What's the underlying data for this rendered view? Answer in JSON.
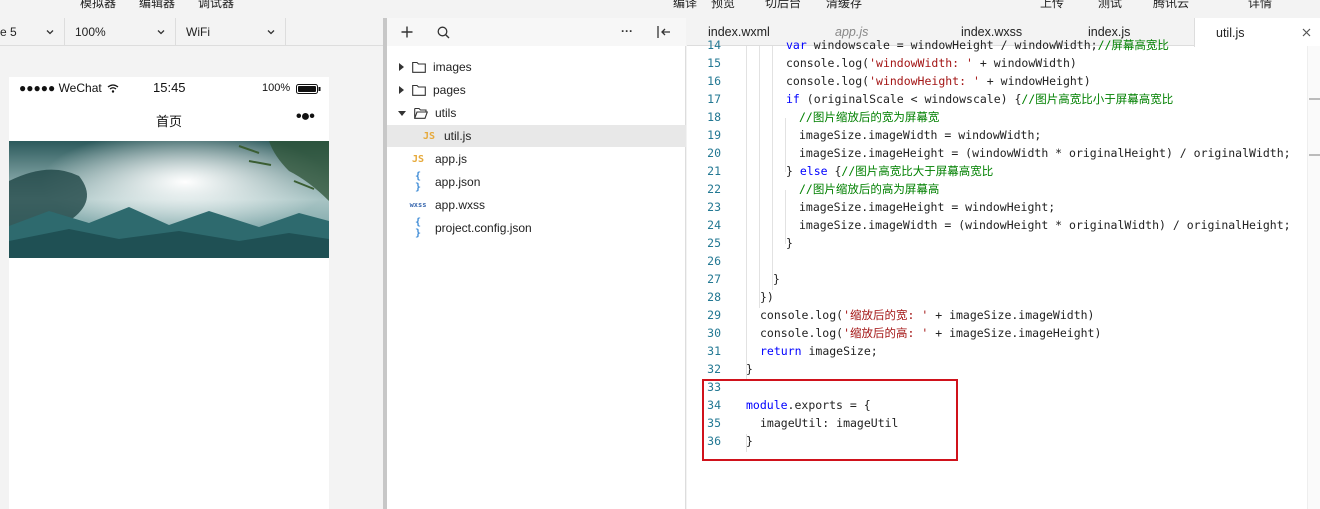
{
  "topbar": {
    "items": [
      "模拟器",
      "编辑器",
      "调试器",
      "编译",
      "预览",
      "切后台",
      "清缓存",
      "上传",
      "测试",
      "腾讯云",
      "详情"
    ]
  },
  "simulator": {
    "device": "e 5",
    "zoom": "100%",
    "network": "WiFi",
    "status": {
      "carrier": "●●●●● WeChat",
      "time": "15:45",
      "battery": "100%"
    },
    "nav_title": "首页",
    "menu_dots": "•●•"
  },
  "tree": {
    "items": [
      {
        "label": "images",
        "type": "folder"
      },
      {
        "label": "pages",
        "type": "folder"
      },
      {
        "label": "utils",
        "type": "folder-open"
      },
      {
        "label": "util.js",
        "type": "js",
        "icon": "JS"
      },
      {
        "label": "app.js",
        "type": "js",
        "icon": "JS"
      },
      {
        "label": "app.json",
        "type": "json",
        "icon": "{ }"
      },
      {
        "label": "app.wxss",
        "type": "wxss",
        "icon": "wxss"
      },
      {
        "label": "project.config.json",
        "type": "json",
        "icon": "{ }"
      }
    ],
    "more": "···"
  },
  "editor": {
    "tabs": [
      {
        "label": "index.wxml"
      },
      {
        "label": "app.js"
      },
      {
        "label": "index.wxss"
      },
      {
        "label": "index.js"
      },
      {
        "label": "util.js"
      }
    ],
    "lines": [
      {
        "n": "14",
        "text": "var windowscale = windowHeight / windowWidth;//屏幕高宽比"
      },
      {
        "n": "15",
        "text": "console.log('windowWidth: ' + windowWidth)"
      },
      {
        "n": "16",
        "text": "console.log('windowHeight: ' + windowHeight)"
      },
      {
        "n": "17",
        "text": "if (originalScale < windowscale) {//图片高宽比小于屏幕高宽比"
      },
      {
        "n": "18",
        "text": "//图片缩放后的宽为屏幕宽"
      },
      {
        "n": "19",
        "text": "imageSize.imageWidth = windowWidth;"
      },
      {
        "n": "20",
        "text": "imageSize.imageHeight = (windowWidth * originalHeight) / originalWidth;"
      },
      {
        "n": "21",
        "text": "} else {//图片高宽比大于屏幕高宽比"
      },
      {
        "n": "22",
        "text": "//图片缩放后的高为屏幕高"
      },
      {
        "n": "23",
        "text": "imageSize.imageHeight = windowHeight;"
      },
      {
        "n": "24",
        "text": "imageSize.imageWidth = (windowHeight * originalWidth) / originalHeight;"
      },
      {
        "n": "25",
        "text": "}"
      },
      {
        "n": "26",
        "text": ""
      },
      {
        "n": "27",
        "text": "}"
      },
      {
        "n": "28",
        "text": "})"
      },
      {
        "n": "29",
        "text": "console.log('缩放后的宽: ' + imageSize.imageWidth)"
      },
      {
        "n": "30",
        "text": "console.log('缩放后的高: ' + imageSize.imageHeight)"
      },
      {
        "n": "31",
        "text": "return imageSize;"
      },
      {
        "n": "32",
        "text": "}"
      },
      {
        "n": "33",
        "text": ""
      },
      {
        "n": "34",
        "text": "module.exports = {"
      },
      {
        "n": "35",
        "text": "imageUtil: imageUtil"
      },
      {
        "n": "36",
        "text": "}"
      }
    ]
  },
  "colors": {
    "accent_box": "#d0121b",
    "line_number": "#237893",
    "comment": "#008000",
    "keyword": "#0000ff",
    "string": "#a31515"
  }
}
